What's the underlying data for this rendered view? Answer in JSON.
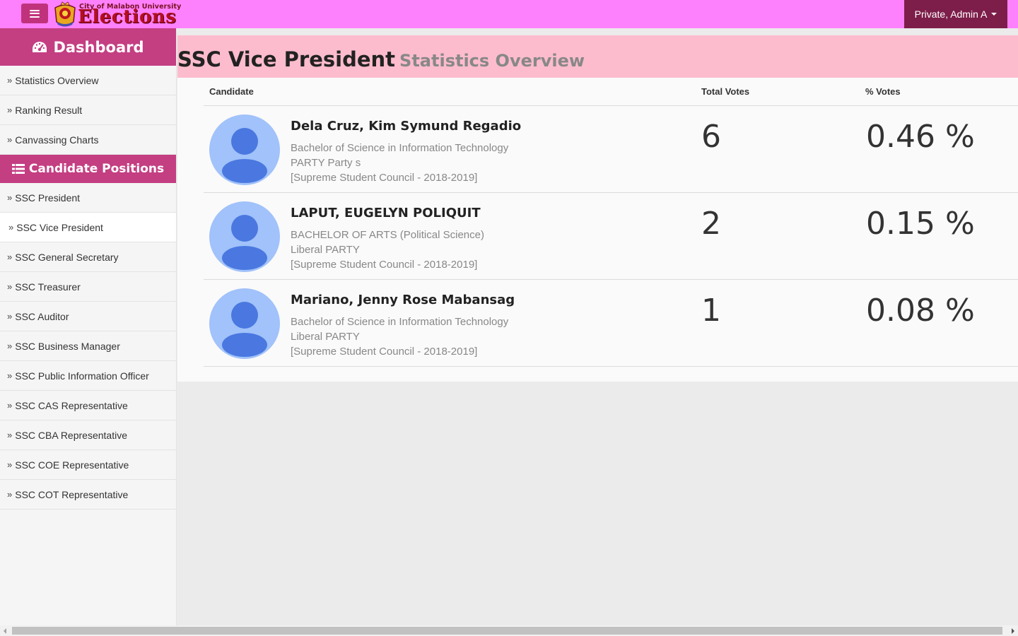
{
  "navbar": {
    "logo_small": "City of Malabon University",
    "logo_big": "Elections",
    "user_label": "Private, Admin A"
  },
  "sidebar": {
    "dashboard_label": "Dashboard",
    "dashboard_items": [
      {
        "label": "Statistics Overview"
      },
      {
        "label": "Ranking Result"
      },
      {
        "label": "Canvassing Charts"
      }
    ],
    "positions_label": "Candidate Positions",
    "position_items": [
      {
        "label": "SSC President"
      },
      {
        "label": "SSC Vice President",
        "active": true
      },
      {
        "label": "SSC General Secretary"
      },
      {
        "label": "SSC Treasurer"
      },
      {
        "label": "SSC Auditor"
      },
      {
        "label": "SSC Business Manager"
      },
      {
        "label": "SSC Public Information Officer"
      },
      {
        "label": "SSC CAS Representative"
      },
      {
        "label": "SSC CBA Representative"
      },
      {
        "label": "SSC COE Representative"
      },
      {
        "label": "SSC COT Representative"
      }
    ]
  },
  "main": {
    "title": "SSC Vice President",
    "subtitle": "Statistics Overview",
    "table": {
      "headers": {
        "candidate": "Candidate",
        "total_votes": "Total Votes",
        "pct_votes": "% Votes"
      },
      "rows": [
        {
          "name": "Dela Cruz, Kim Symund Regadio",
          "course": "Bachelor of Science in Information Technology",
          "party": "PARTY Party s",
          "council": "[Supreme Student Council - 2018-2019]",
          "votes": "6",
          "pct": "0.46 %"
        },
        {
          "name": "LAPUT, EUGELYN POLIQUIT",
          "course": "BACHELOR OF ARTS (Political Science)",
          "party": "Liberal PARTY",
          "council": "[Supreme Student Council - 2018-2019]",
          "votes": "2",
          "pct": "0.15 %"
        },
        {
          "name": "Mariano, Jenny Rose Mabansag",
          "course": "Bachelor of Science in Information Technology",
          "party": "Liberal PARTY",
          "council": "[Supreme Student Council - 2018-2019]",
          "votes": "1",
          "pct": "0.08 %"
        }
      ]
    }
  },
  "colors": {
    "navbar": "#fd80fd",
    "accent": "#c43e82",
    "user_button": "#7d1e4a",
    "title_bar": "#fdbccd",
    "avatar_bg": "#a1c2fa",
    "avatar_fg": "#4a78e0"
  },
  "icons": {
    "menu": "hamburger-icon",
    "dashboard": "tachometer-icon",
    "positions": "list-icon",
    "item": "double-chevron-right-icon",
    "avatar": "default-user-icon"
  }
}
